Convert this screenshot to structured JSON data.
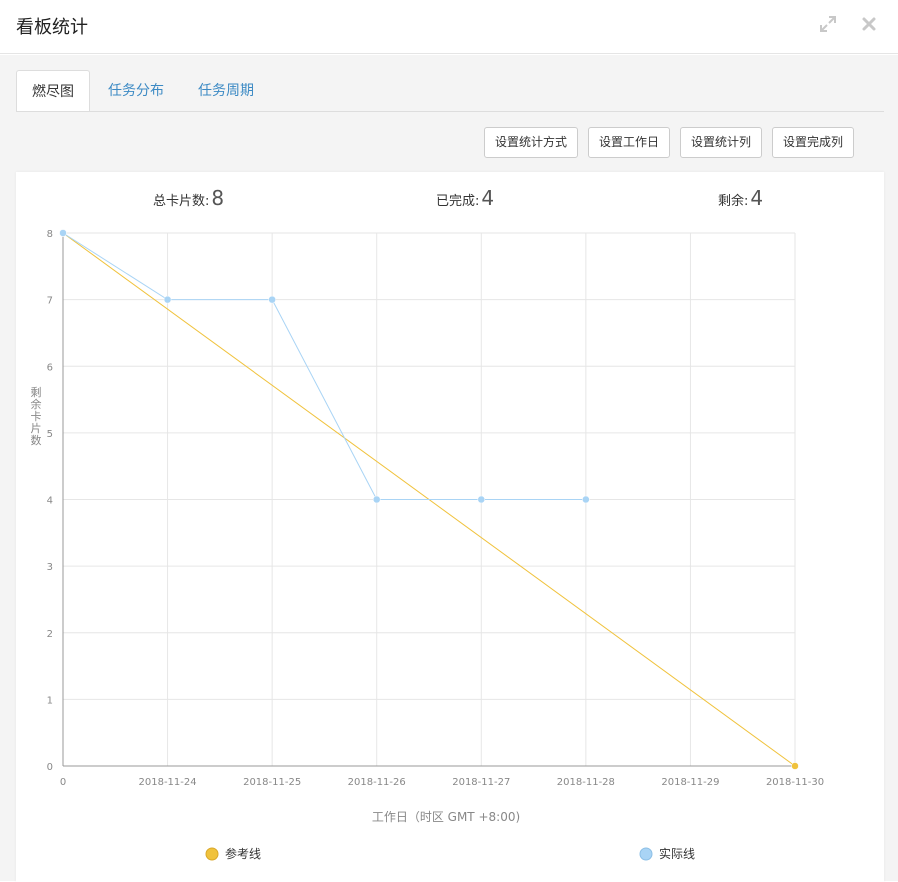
{
  "dialog": {
    "title": "看板统计",
    "expand_icon": "expand-icon",
    "close_icon": "close-icon"
  },
  "tabs": [
    {
      "label": "燃尽图",
      "active": true
    },
    {
      "label": "任务分布",
      "active": false
    },
    {
      "label": "任务周期",
      "active": false
    }
  ],
  "toolbar": {
    "stat_method_label": "设置统计方式",
    "workday_label": "设置工作日",
    "stat_columns_label": "设置统计列",
    "done_columns_label": "设置完成列"
  },
  "stats": {
    "total_label": "总卡片数:",
    "total_value": "8",
    "done_label": "已完成:",
    "done_value": "4",
    "remaining_label": "剩余:",
    "remaining_value": "4"
  },
  "colors": {
    "reference": "#f0c23c",
    "actual": "#a9d4f5",
    "tab_link": "#3c8ac4"
  },
  "chart_data": {
    "type": "line",
    "categories": [
      "0",
      "2018-11-24",
      "2018-11-25",
      "2018-11-26",
      "2018-11-27",
      "2018-11-28",
      "2018-11-29",
      "2018-11-30"
    ],
    "series": [
      {
        "name": "参考线",
        "values": [
          8,
          null,
          null,
          null,
          null,
          null,
          null,
          0
        ],
        "color": "#f0c23c"
      },
      {
        "name": "实际线",
        "values": [
          8,
          7,
          7,
          4,
          4,
          4,
          null,
          null
        ],
        "color": "#a9d4f5"
      }
    ],
    "xlabel": "工作日（时区 GMT +8:00)",
    "ylabel": "剩余卡片数",
    "ylim": [
      0,
      8
    ],
    "yticks": [
      0,
      1,
      2,
      3,
      4,
      5,
      6,
      7,
      8
    ],
    "grid": true,
    "legend": "bottom"
  }
}
